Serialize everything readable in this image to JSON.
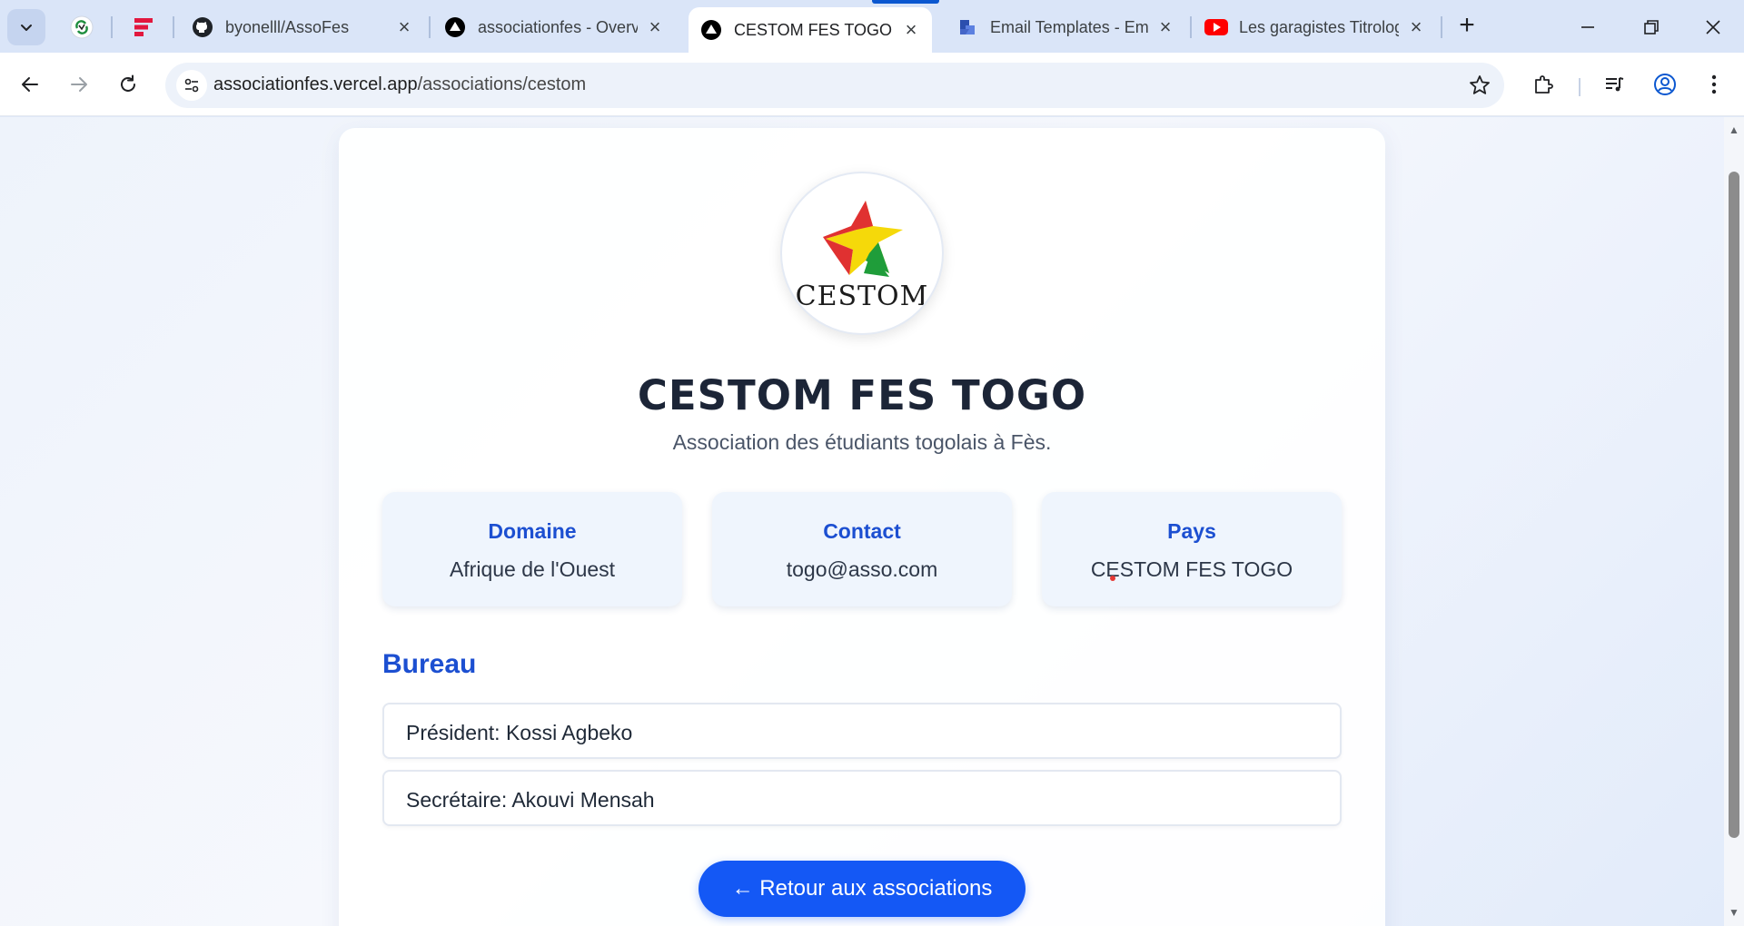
{
  "browser": {
    "tabs": [
      {
        "title": "byonelll/AssoFes",
        "icon": "github-icon"
      },
      {
        "title": "associationfes - Overview",
        "icon": "vercel-icon"
      },
      {
        "title": "CESTOM FES TOGO | Associations",
        "icon": "vercel-icon",
        "active": true
      },
      {
        "title": "Email Templates - EmailJS",
        "icon": "emailjs-icon"
      },
      {
        "title": "Les garagistes Titrologie",
        "icon": "youtube-icon"
      }
    ],
    "new_tab_label": "+",
    "address_bar": {
      "domain": "associationfes.vercel.app",
      "path": "/associations/cestom"
    }
  },
  "page": {
    "logo_text": "CESTOM",
    "title": "CESTOM FES TOGO",
    "description": "Association des étudiants togolais à Fès.",
    "info_cards": [
      {
        "label": "Domaine",
        "value": "Afrique de l'Ouest"
      },
      {
        "label": "Contact",
        "value": "togo@asso.com"
      },
      {
        "label": "Pays",
        "value": "CESTOM FES TOGO"
      }
    ],
    "bureau": {
      "heading": "Bureau",
      "members": [
        "Président: Kossi Agbeko",
        "Secrétaire: Akouvi Mensah"
      ]
    },
    "back_button": "← Retour aux associations"
  },
  "colors": {
    "accent": "#1c4fd1",
    "button": "#1458f5",
    "logo_red": "#e03131",
    "logo_yellow": "#f5d90a",
    "logo_green": "#1f9d3a"
  }
}
